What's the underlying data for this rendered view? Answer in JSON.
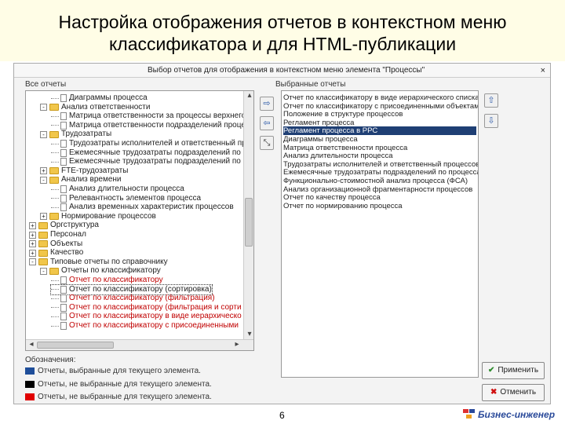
{
  "slide": {
    "title_line1": "Настройка отображения отчетов в контекстном меню",
    "title_line2": "классификатора и для HTML-публикации",
    "page_number": "6",
    "logo_text": "Бизнес-инженер"
  },
  "dialog": {
    "title": "Выбор отчетов для отображения в контекстном меню элемента \"Процессы\"",
    "close_glyph": "×",
    "left_label": "Все отчеты",
    "right_label": "Выбранные отчеты",
    "legend_label": "Обозначения:",
    "legend": [
      {
        "text": "Отчеты, выбранные для текущего элемента.",
        "color": "#1f4e9a"
      },
      {
        "text": "Отчеты, не выбранные для текущего элемента.",
        "color": "#000000"
      },
      {
        "text": "Отчеты, не выбранные для текущего элемента.",
        "color": "#e00000"
      }
    ],
    "apply_label": "Применить",
    "cancel_label": "Отменить",
    "apply_icon": "check-icon",
    "cancel_icon": "cross-icon"
  },
  "tree": [
    {
      "text": "Диаграммы процесса",
      "kind": "doc",
      "depth": 3
    },
    {
      "text": "Анализ ответственности",
      "kind": "folder",
      "depth": 2,
      "expander": "-"
    },
    {
      "text": "Матрица ответственности за процессы верхнего",
      "kind": "doc",
      "depth": 3
    },
    {
      "text": "Матрица ответственности подразделений процесса",
      "kind": "doc",
      "depth": 3
    },
    {
      "text": "Трудозатраты",
      "kind": "folder",
      "depth": 2,
      "expander": "-"
    },
    {
      "text": "Трудозатраты исполнителей и ответственный про",
      "kind": "doc",
      "depth": 3
    },
    {
      "text": "Ежемесячные трудозатраты подразделений по о",
      "kind": "doc",
      "depth": 3
    },
    {
      "text": "Ежемесячные трудозатраты подразделений по о",
      "kind": "doc",
      "depth": 3
    },
    {
      "text": "FTE-трудозатраты",
      "kind": "folder",
      "depth": 2,
      "expander": "+"
    },
    {
      "text": "Анализ времени",
      "kind": "folder",
      "depth": 2,
      "expander": "-"
    },
    {
      "text": "Анализ длительности процесса",
      "kind": "doc",
      "depth": 3
    },
    {
      "text": "Релевантность элементов процесса",
      "kind": "doc",
      "depth": 3
    },
    {
      "text": "Анализ временных характеристик процессов",
      "kind": "doc",
      "depth": 3
    },
    {
      "text": "Нормирование процессов",
      "kind": "folder",
      "depth": 2,
      "expander": "+"
    },
    {
      "text": "Оргструктура",
      "kind": "folder",
      "depth": 1,
      "expander": "+"
    },
    {
      "text": "Персонал",
      "kind": "folder",
      "depth": 1,
      "expander": "+"
    },
    {
      "text": "Объекты",
      "kind": "folder",
      "depth": 1,
      "expander": "+"
    },
    {
      "text": "Качество",
      "kind": "folder",
      "depth": 1,
      "expander": "+"
    },
    {
      "text": "Типовые отчеты по справочнику",
      "kind": "folder",
      "depth": 1,
      "expander": "-"
    },
    {
      "text": "Отчеты по классификатору",
      "kind": "folder",
      "depth": 2,
      "expander": "-"
    },
    {
      "text": "Отчет по классификатору",
      "kind": "doc",
      "depth": 3,
      "color": "red"
    },
    {
      "text": "Отчет по классификатору (сортировка)",
      "kind": "doc",
      "depth": 3,
      "selected": true
    },
    {
      "text": "Отчет по классификатору (фильтрация)",
      "kind": "doc",
      "depth": 3,
      "color": "red"
    },
    {
      "text": "Отчет по классификатору (фильтрация и сорти",
      "kind": "doc",
      "depth": 3,
      "color": "red"
    },
    {
      "text": "Отчет по классификатору в виде иерархическо",
      "kind": "doc",
      "depth": 3,
      "color": "red"
    },
    {
      "text": "Отчет по классификатору с присоединенными",
      "kind": "doc",
      "depth": 3,
      "color": "red"
    }
  ],
  "selected_reports": [
    {
      "text": "Отчет по классификатору в виде иерархического списка"
    },
    {
      "text": "Отчет по классификатору с присоединенными объектами"
    },
    {
      "text": "Положение в структуре процессов"
    },
    {
      "text": "Регламент процесса"
    },
    {
      "text": "Регламент процесса в РРС",
      "highlighted": true
    },
    {
      "text": "Диаграммы процесса"
    },
    {
      "text": "Матрица ответственности процесса"
    },
    {
      "text": "Анализ длительности процесса"
    },
    {
      "text": "Трудозатраты исполнителей и ответственный процессов"
    },
    {
      "text": "Ежемесячные трудозатраты подразделений по процессам"
    },
    {
      "text": "Функционально-стоимостной анализ процесса (ФСА)"
    },
    {
      "text": "Анализ организационной фрагментарности процессов"
    },
    {
      "text": "Отчет по качеству процесса"
    },
    {
      "text": "Отчет по нормированию процесса"
    }
  ],
  "transfer_buttons": [
    {
      "glyph": "⇨",
      "name": "add-to-selected-button"
    },
    {
      "glyph": "⇦",
      "name": "remove-from-selected-button"
    },
    {
      "glyph": "⤡",
      "name": "reset-selection-button"
    }
  ],
  "order_buttons": [
    {
      "glyph": "⇧",
      "name": "move-up-button"
    },
    {
      "glyph": "⇩",
      "name": "move-down-button"
    }
  ]
}
